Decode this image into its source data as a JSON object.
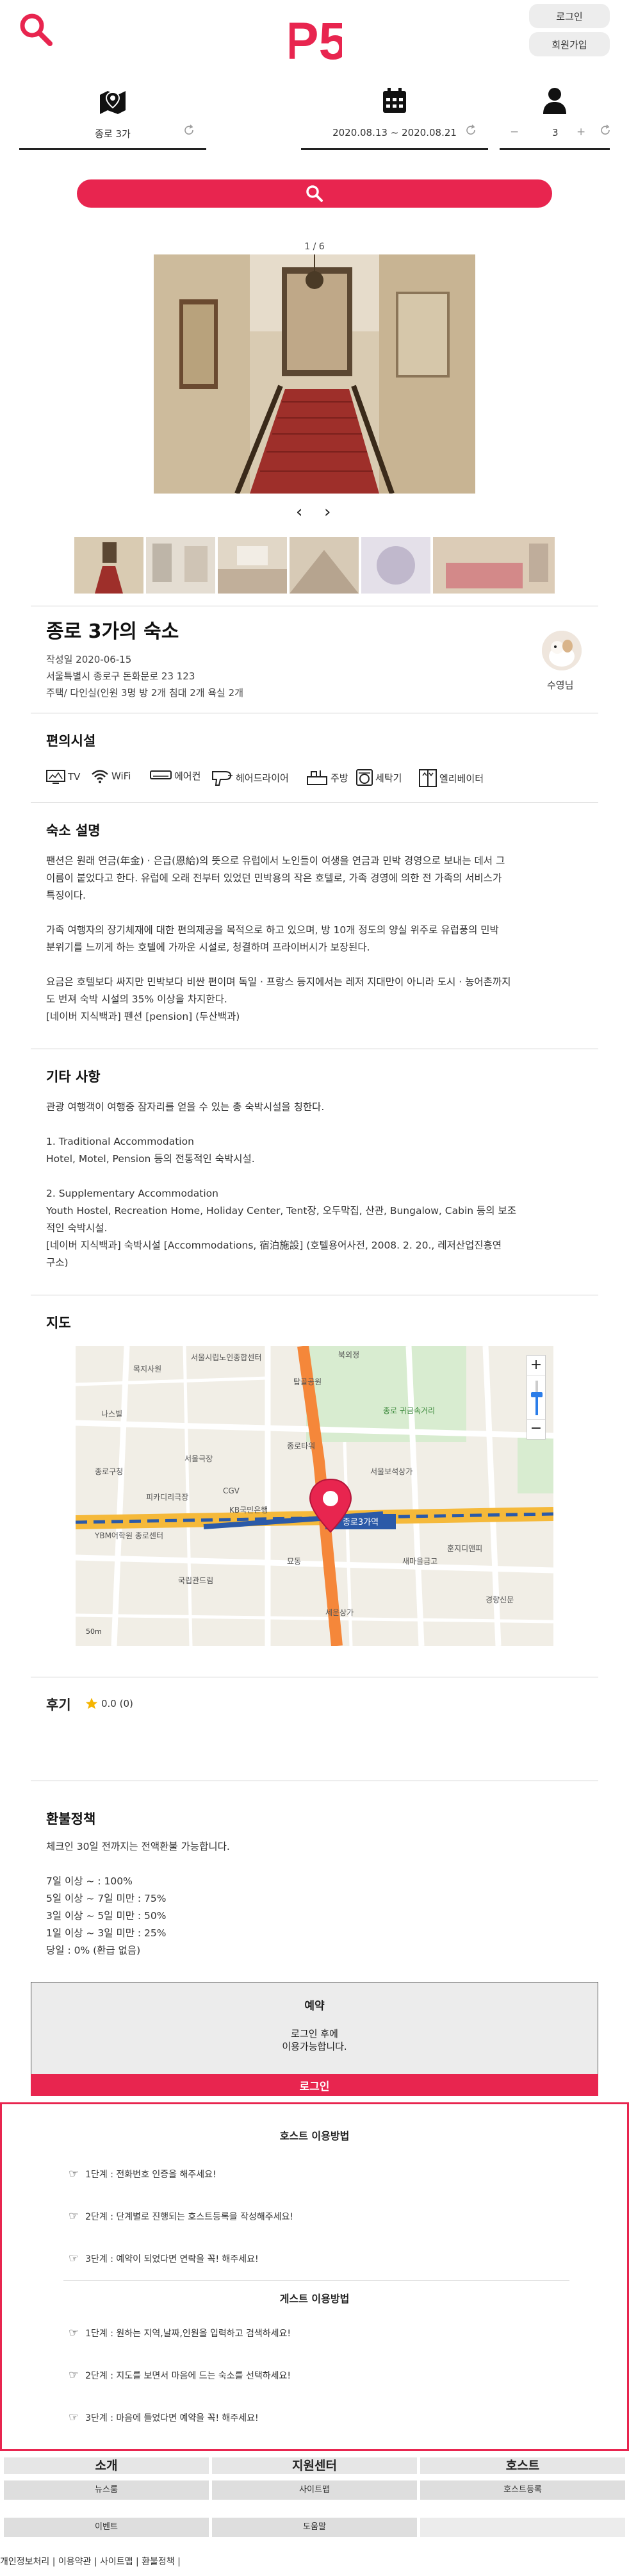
{
  "header": {
    "logo_text": "P5",
    "login_label": "로그인",
    "signup_label": "회원가입"
  },
  "filters": {
    "location": "종로 3가",
    "dates": "2020.08.13 ~ 2020.08.21",
    "guests": "3",
    "minus": "−",
    "plus": "+"
  },
  "gallery": {
    "counter": "1 / 6",
    "prev": "‹",
    "next": "›",
    "thumb_count": 6,
    "active_thumb": 1
  },
  "listing": {
    "title": "종로 3가의 숙소",
    "date": "작성일 2020-06-15",
    "address": "서울특별시 종로구 돈화문로 23 123",
    "type": "주택/ 다인실(인원 3명 방 2개 침대 2개 욕실 2개",
    "host_name": "수영님"
  },
  "amenities": {
    "title": "편의시설",
    "items": [
      {
        "icon": "tv-icon",
        "label": "TV"
      },
      {
        "icon": "wifi-icon",
        "label": "WiFi"
      },
      {
        "icon": "aircon-icon",
        "label": "에어컨"
      },
      {
        "icon": "hairdryer-icon",
        "label": "헤어드라이어"
      },
      {
        "icon": "kitchen-icon",
        "label": "주방"
      },
      {
        "icon": "washer-icon",
        "label": "세탁기"
      },
      {
        "icon": "elevator-icon",
        "label": "엘리베이터"
      }
    ]
  },
  "description": {
    "title": "숙소 설명",
    "lines": [
      "팬션은 원래 연금(年金) · 은급(恩給)의 뜻으로 유럽에서 노인들이 여생을 연금과 민박 경영으로 보내는 데서 그",
      "이름이 붙었다고 한다. 유럽에 오래 전부터 있었던 민박용의 작은 호텔로, 가족 경영에 의한 전 가족의 서비스가",
      "특징이다.",
      "",
      "가족 여행자의 장기체재에 대한 편의제공을 목적으로 하고 있으며, 방 10개 정도의 양실 위주로 유럽풍의 민박",
      "분위기를 느끼게 하는 호텔에 가까운 시설로, 청결하며 프라이버시가 보장된다.",
      "",
      "요금은 호텔보다 싸지만 민박보다 비싼 편이며 독일 · 프랑스 등지에서는 레저 지대만이 아니라 도시 · 농어촌까지",
      "도 번져 숙박 시설의 35% 이상을 차지한다.",
      "[네이버 지식백과] 펜션 [pension] (두산백과)"
    ]
  },
  "other": {
    "title": "기타 사항",
    "lines": [
      "관광 여행객이 여행중 잠자리를 얻을 수 있는 총 숙박시설을 칭한다.",
      "",
      "1. Traditional Accommodation",
      "Hotel, Motel, Pension 등의 전통적인 숙박시설.",
      "",
      "2. Supplementary Accommodation",
      "Youth Hostel, Recreation Home, Holiday Center, Tent장, 오두막집, 산관, Bungalow, Cabin 등의 보조",
      "적인 숙박시설.",
      "[네이버 지식백과] 숙박시설 [Accommodations, 宿泊施設] (호텔용어사전, 2008. 2. 20., 레저산업진흥연",
      "구소)"
    ]
  },
  "map": {
    "title": "지도",
    "station_label": "종로3가역",
    "labels": [
      "서울시립노인종합센터",
      "북외정",
      "목지사원",
      "탑골공원",
      "나스빌",
      "종로 귀금속거리",
      "종로타워",
      "서울극장",
      "YBM어학원 종로센터",
      "KB국민은행",
      "서울보석상가",
      "피카디리극장",
      "국립관드림",
      "CGV",
      "묘동",
      "세운상가",
      "훈지디앤피",
      "경향신문",
      "새마을금고",
      "종로구청"
    ],
    "zoom_in": "+",
    "zoom_out": "−",
    "scale": "50m"
  },
  "reviews": {
    "title": "후기",
    "score": "0.0 (0)"
  },
  "refund": {
    "title": "환불정책",
    "lines": [
      "체크인 30일 전까지는 전액환불 가능합니다.",
      "",
      "7일 이상 ~ : 100%",
      "5일 이상 ~ 7일 미만 : 75%",
      "3일 이상 ~ 5일 미만 : 50%",
      "1일 이상 ~ 3일 미만 : 25%",
      "당일 : 0% (환급 없음)"
    ]
  },
  "booking": {
    "title": "예약",
    "message_1": "로그인 후에",
    "message_2": "이용가능합니다.",
    "login_label": "로그인"
  },
  "guide": {
    "host_title": "호스트 이용방법",
    "host_steps": [
      "1단계 : 전화번호 인증을 해주세요!",
      "2단계 : 단계별로 진행되는 호스트등록을 작성해주세요!",
      "3단계 : 예약이 되었다면 연락을 꼭! 해주세요!"
    ],
    "guest_title": "게스트 이용방법",
    "guest_steps": [
      "1단계 : 원하는 지역,날짜,인원을 입력하고 검색하세요!",
      "2단계 : 지도를 보면서 마음에 드는 숙소를 선택하세요!",
      "3단계 : 마음에 들었다면 예약을 꼭! 해주세요!"
    ]
  },
  "footer": {
    "col1_title": "소개",
    "col1_links": [
      "뉴스룸",
      "이벤트"
    ],
    "col2_title": "지원센터",
    "col2_links": [
      "사이트맵",
      "도움말"
    ],
    "col3_title": "호스트",
    "col3_links": [
      "호스트등록"
    ],
    "copyright": "개인정보처리 | 이용약관 | 사이트맵 | 환불정책 |"
  },
  "colors": {
    "accent": "#e8254f",
    "panel": "#ececec"
  }
}
